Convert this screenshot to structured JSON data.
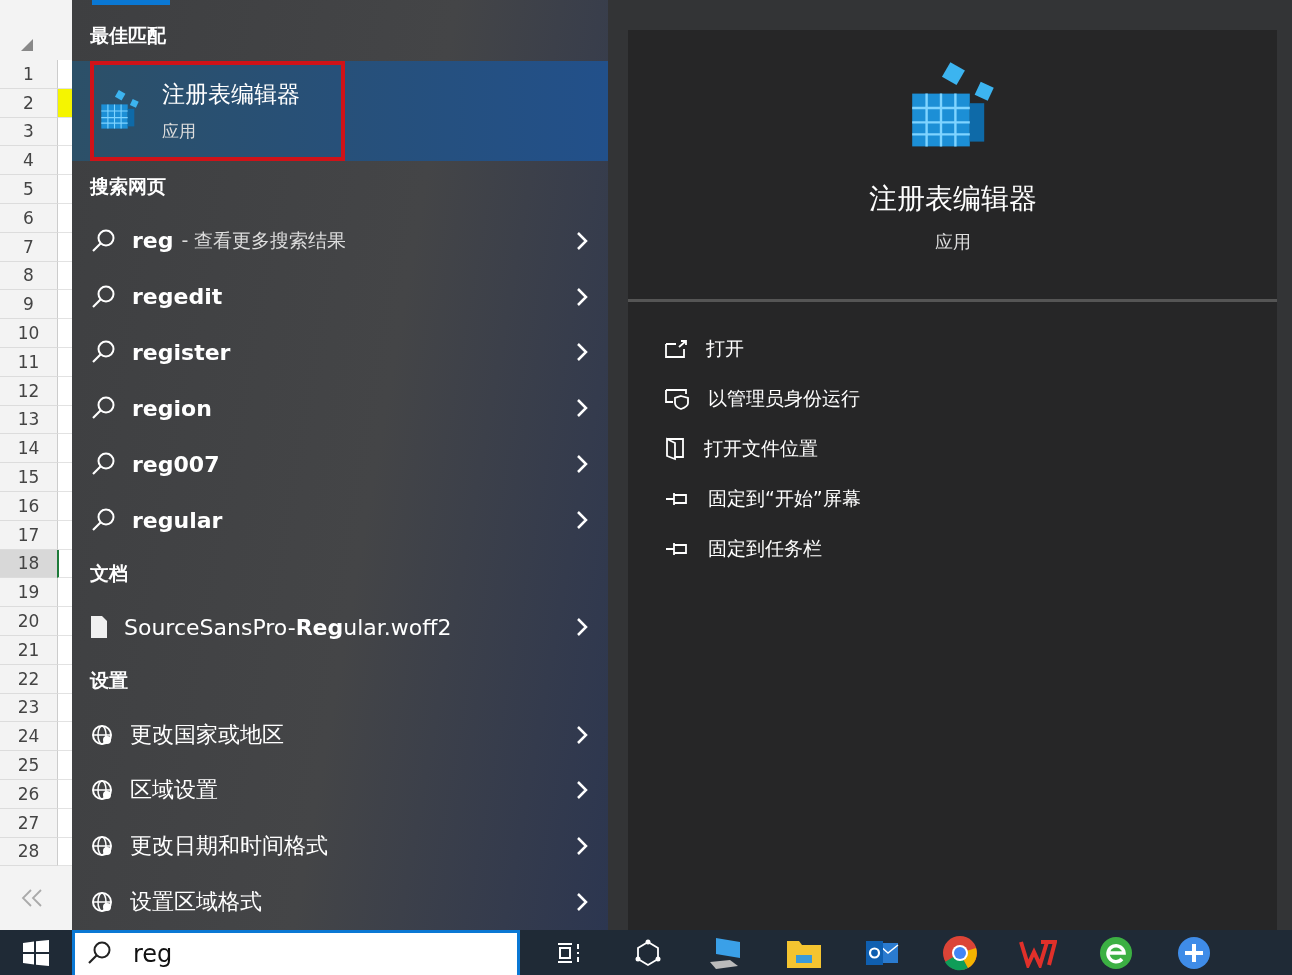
{
  "spreadsheet": {
    "rows": [
      {
        "label": "1",
        "selected": false
      },
      {
        "label": "2",
        "selected": false
      },
      {
        "label": "3",
        "selected": false
      },
      {
        "label": "4",
        "selected": false
      },
      {
        "label": "5",
        "selected": false
      },
      {
        "label": "6",
        "selected": false
      },
      {
        "label": "7",
        "selected": false
      },
      {
        "label": "8",
        "selected": false
      },
      {
        "label": "9",
        "selected": false
      },
      {
        "label": "10",
        "selected": false
      },
      {
        "label": "11",
        "selected": false
      },
      {
        "label": "12",
        "selected": false
      },
      {
        "label": "13",
        "selected": false
      },
      {
        "label": "14",
        "selected": false
      },
      {
        "label": "15",
        "selected": false
      },
      {
        "label": "16",
        "selected": false
      },
      {
        "label": "17",
        "selected": false
      },
      {
        "label": "18",
        "selected": true
      },
      {
        "label": "19",
        "selected": false
      },
      {
        "label": "20",
        "selected": false
      },
      {
        "label": "21",
        "selected": false
      },
      {
        "label": "22",
        "selected": false
      },
      {
        "label": "23",
        "selected": false
      },
      {
        "label": "24",
        "selected": false
      },
      {
        "label": "25",
        "selected": false
      },
      {
        "label": "26",
        "selected": false
      },
      {
        "label": "27",
        "selected": false
      },
      {
        "label": "28",
        "selected": false
      }
    ]
  },
  "results": {
    "best_match": {
      "heading": "最佳匹配",
      "title": "注册表编辑器",
      "subtitle": "应用",
      "selected": true
    },
    "sections": [
      {
        "heading": "搜索网页",
        "items": [
          {
            "kind": "web",
            "label": "reg",
            "hint": "- 查看更多搜索结果"
          },
          {
            "kind": "web",
            "label": "regedit"
          },
          {
            "kind": "web",
            "label": "register"
          },
          {
            "kind": "web",
            "label": "region"
          },
          {
            "kind": "web",
            "label": "reg007"
          },
          {
            "kind": "web",
            "label": "regular"
          }
        ]
      },
      {
        "heading": "文档",
        "items": [
          {
            "kind": "doc",
            "label": "SourceSansPro-**Reg**ular.woff2"
          }
        ]
      },
      {
        "heading": "设置",
        "items": [
          {
            "kind": "setting",
            "label": "更改国家或地区"
          },
          {
            "kind": "setting",
            "label": "区域设置"
          },
          {
            "kind": "setting",
            "label": "更改日期和时间格式"
          },
          {
            "kind": "setting",
            "label": "设置区域格式"
          }
        ]
      }
    ]
  },
  "preview": {
    "title": "注册表编辑器",
    "subtitle": "应用",
    "actions": [
      {
        "kind": "open",
        "label": "打开"
      },
      {
        "kind": "admin",
        "label": "以管理员身份运行"
      },
      {
        "kind": "location",
        "label": "打开文件位置"
      },
      {
        "kind": "pin",
        "label": "固定到“开始”屏幕"
      },
      {
        "kind": "pin",
        "label": "固定到任务栏"
      }
    ]
  },
  "taskbar": {
    "search": {
      "value": "reg"
    }
  }
}
